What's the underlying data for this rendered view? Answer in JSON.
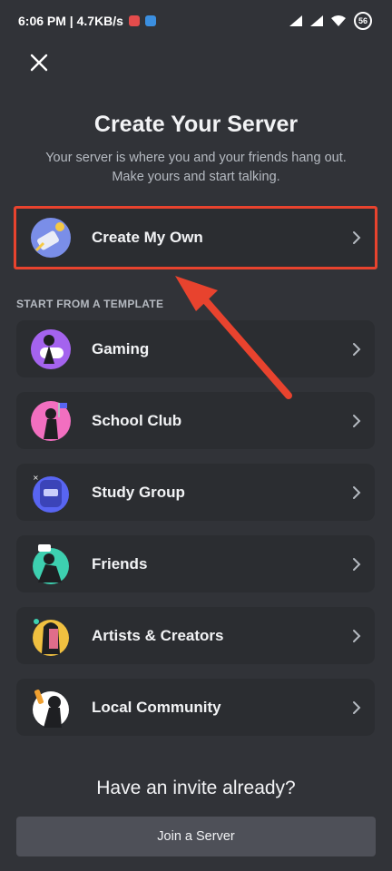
{
  "status_bar": {
    "time_net": "6:06 PM | 4.7KB/s",
    "battery": "56"
  },
  "header": {
    "close_icon": "close-icon",
    "title": "Create Your Server",
    "subtitle_line1": "Your server is where you and your friends hang out.",
    "subtitle_line2": "Make yours and start talking."
  },
  "create_own": {
    "label": "Create My Own",
    "highlight_color": "#e8432e"
  },
  "templates": {
    "section_label": "START FROM A TEMPLATE",
    "items": [
      {
        "label": "Gaming",
        "icon": "gaming-icon",
        "color": "#a463ee"
      },
      {
        "label": "School Club",
        "icon": "school-club-icon",
        "color": "#f26fc0"
      },
      {
        "label": "Study Group",
        "icon": "study-group-icon",
        "color": "#5865f2"
      },
      {
        "label": "Friends",
        "icon": "friends-icon",
        "color": "#3dd0b0"
      },
      {
        "label": "Artists & Creators",
        "icon": "artists-icon",
        "color": "#f0c040"
      },
      {
        "label": "Local Community",
        "icon": "local-community-icon",
        "color": "#ffffff"
      }
    ]
  },
  "footer": {
    "invite_heading": "Have an invite already?",
    "join_label": "Join a Server"
  },
  "colors": {
    "background": "#313338",
    "card": "#2b2d31",
    "button": "#4e5058",
    "annotation_arrow": "#e8432e"
  }
}
